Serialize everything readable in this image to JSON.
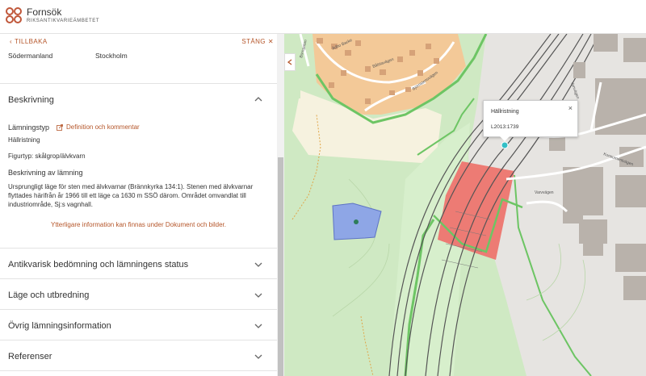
{
  "app": {
    "name": "Fornsök",
    "subtitle": "RIKSANTIKVARIEÄMBETET"
  },
  "panel": {
    "back_label": "TILLBAKA",
    "close_label": "STÄNG",
    "place_left": "Södermanland",
    "place_right": "Stockholm",
    "description": {
      "header": "Beskrivning",
      "type_label": "Lämningstyp",
      "definition_link": "Definition och kommentar",
      "type_value": "Hällristning",
      "figure_type": "Figurtyp: skålgrop/älvkvarn",
      "desc_heading": "Beskrivning av lämning",
      "desc_lines": [
        "Ursprungligt läge för sten med älvkvarnar (Brännkyrka 134:1). Stenen med älvkvarnar",
        "flyttades härifrån år 1966 till ett läge ca 1630 m SSÖ därom. Området omvandlat till",
        "industriområde, Sj:s vagnhall."
      ],
      "more_info": "Ytterligare information kan finnas under Dokument och bilder."
    },
    "sections": [
      {
        "label": "Antikvarisk bedömning och lämningens status"
      },
      {
        "label": "Läge och utbredning"
      },
      {
        "label": "Övrig lämningsinformation"
      },
      {
        "label": "Referenser"
      }
    ]
  },
  "map": {
    "popup_title": "Hällristning",
    "popup_id": "L2013:1739",
    "streets": [
      "Vanvägen",
      "Konsumentvägen",
      "Varvvägen",
      "Björnstensvägen",
      "Ärlbo Backe",
      "Bålstavägen",
      "Boregatan"
    ],
    "colors": {
      "grass": "#cfe9c3",
      "residential": "#f2c89a",
      "industrial": "#e8e6e3",
      "building": "#b9b2ab",
      "sand": "#f6f1dd",
      "highlight": "#ed7b74",
      "feature": "#8ea6e6",
      "brand": "#b5562a"
    }
  }
}
